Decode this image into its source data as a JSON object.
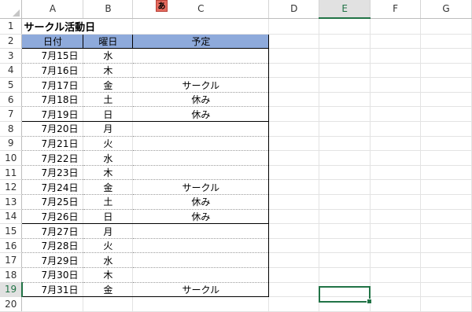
{
  "columns": [
    "A",
    "B",
    "C",
    "D",
    "E",
    "F",
    "G"
  ],
  "active_column": "E",
  "row_numbers": [
    "1",
    "2",
    "3",
    "4",
    "5",
    "6",
    "7",
    "8",
    "9",
    "10",
    "11",
    "12",
    "13",
    "14",
    "15",
    "16",
    "17",
    "18",
    "19",
    "20"
  ],
  "active_row": "19",
  "ime_indicator": "あ",
  "sheet": {
    "title": "サークル活動日",
    "headers": [
      "日付",
      "曜日",
      "予定"
    ],
    "rows": [
      {
        "date": "7月15日",
        "day": "水",
        "plan": ""
      },
      {
        "date": "7月16日",
        "day": "木",
        "plan": ""
      },
      {
        "date": "7月17日",
        "day": "金",
        "plan": "サークル"
      },
      {
        "date": "7月18日",
        "day": "土",
        "plan": "休み"
      },
      {
        "date": "7月19日",
        "day": "日",
        "plan": "休み"
      },
      {
        "date": "7月20日",
        "day": "月",
        "plan": ""
      },
      {
        "date": "7月21日",
        "day": "火",
        "plan": ""
      },
      {
        "date": "7月22日",
        "day": "水",
        "plan": ""
      },
      {
        "date": "7月23日",
        "day": "木",
        "plan": ""
      },
      {
        "date": "7月24日",
        "day": "金",
        "plan": "サークル"
      },
      {
        "date": "7月25日",
        "day": "土",
        "plan": "休み"
      },
      {
        "date": "7月26日",
        "day": "日",
        "plan": "休み"
      },
      {
        "date": "7月27日",
        "day": "月",
        "plan": ""
      },
      {
        "date": "7月28日",
        "day": "火",
        "plan": ""
      },
      {
        "date": "7月29日",
        "day": "水",
        "plan": ""
      },
      {
        "date": "7月30日",
        "day": "木",
        "plan": ""
      },
      {
        "date": "7月31日",
        "day": "金",
        "plan": "サークル"
      }
    ]
  },
  "colors": {
    "header_fill": "#8eaadb",
    "selection": "#217346",
    "ime_badge": "#e46a5e"
  }
}
